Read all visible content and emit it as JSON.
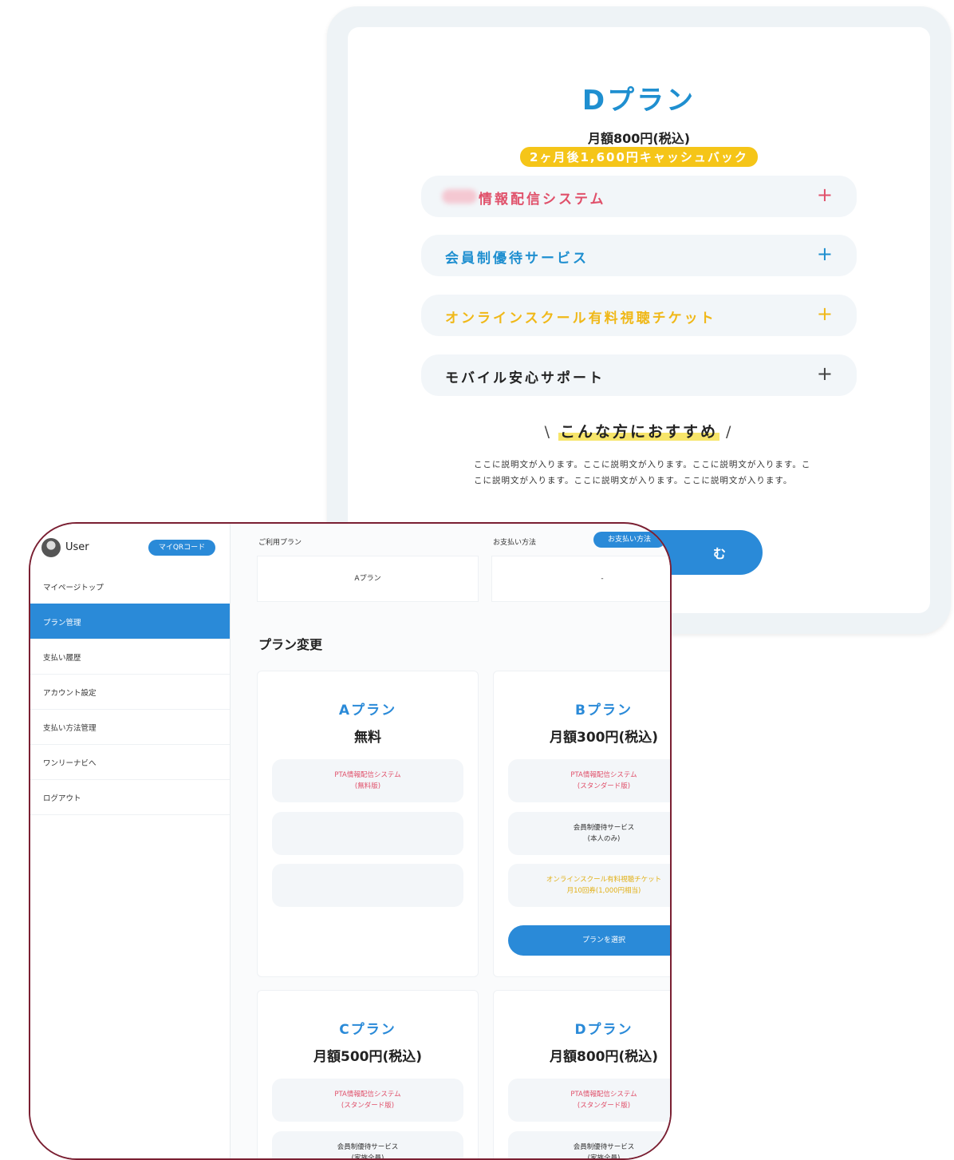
{
  "detail": {
    "plan_name": "Dプラン",
    "price": "月額800円(税込)",
    "cashback": "2ヶ月後1,600円キャッシュバック",
    "accordion": [
      {
        "label": "情報配信システム",
        "color": "#e0506a"
      },
      {
        "label": "会員制優待サービス",
        "color": "#1f8fd0"
      },
      {
        "label": "オンラインスクール有料視聴チケット",
        "color": "#f0b818"
      },
      {
        "label": "モバイル安心サポート",
        "color": "#222222"
      }
    ],
    "plus": "+",
    "recommend_title": "こんな方におすすめ",
    "recommend_left": "\\",
    "recommend_right": "/",
    "description": "ここに説明文が入ります。ここに説明文が入ります。ここに説明文が入ります。ここに説明文が入ります。ここに説明文が入ります。ここに説明文が入ります。",
    "apply_fragment": "む"
  },
  "dashboard": {
    "user_name": "User",
    "qr_button": "マイQRコード",
    "nav": [
      "マイページトップ",
      "プラン管理",
      "支払い履歴",
      "アカウント設定",
      "支払い方法管理",
      "ワンリーナビへ",
      "ログアウト"
    ],
    "current_plan_label": "ご利用プラン",
    "current_plan_value": "Aプラン",
    "payment_label": "お支払い方法",
    "payment_value": "-",
    "payment_button": "お支払い方法",
    "change_title": "プラン変更",
    "plans": [
      {
        "name": "Aプラン",
        "price": "無料",
        "features": [
          {
            "line1": "PTA情報配信システム",
            "line2": "(無料版)",
            "tone": "red"
          },
          {
            "line1": "",
            "line2": "",
            "tone": "dark"
          },
          {
            "line1": "",
            "line2": "",
            "tone": "dark"
          }
        ]
      },
      {
        "name": "Bプラン",
        "price": "月額300円(税込)",
        "features": [
          {
            "line1": "PTA情報配信システム",
            "line2": "(スタンダード版)",
            "tone": "red"
          },
          {
            "line1": "会員制優待サービス",
            "line2": "(本人のみ)",
            "tone": "dark"
          },
          {
            "line1": "オンラインスクール有料視聴チケット",
            "line2": "月10回券(1,000円相当)",
            "tone": "yellow"
          }
        ],
        "button": "プランを選択"
      },
      {
        "name": "Cプラン",
        "price": "月額500円(税込)",
        "features": [
          {
            "line1": "PTA情報配信システム",
            "line2": "(スタンダード版)",
            "tone": "red"
          },
          {
            "line1": "会員制優待サービス",
            "line2": "(家族全員)",
            "tone": "dark"
          }
        ]
      },
      {
        "name": "Dプラン",
        "price": "月額800円(税込)",
        "features": [
          {
            "line1": "PTA情報配信システム",
            "line2": "(スタンダード版)",
            "tone": "red"
          },
          {
            "line1": "会員制優待サービス",
            "line2": "(家族全員)",
            "tone": "dark"
          }
        ]
      }
    ]
  }
}
